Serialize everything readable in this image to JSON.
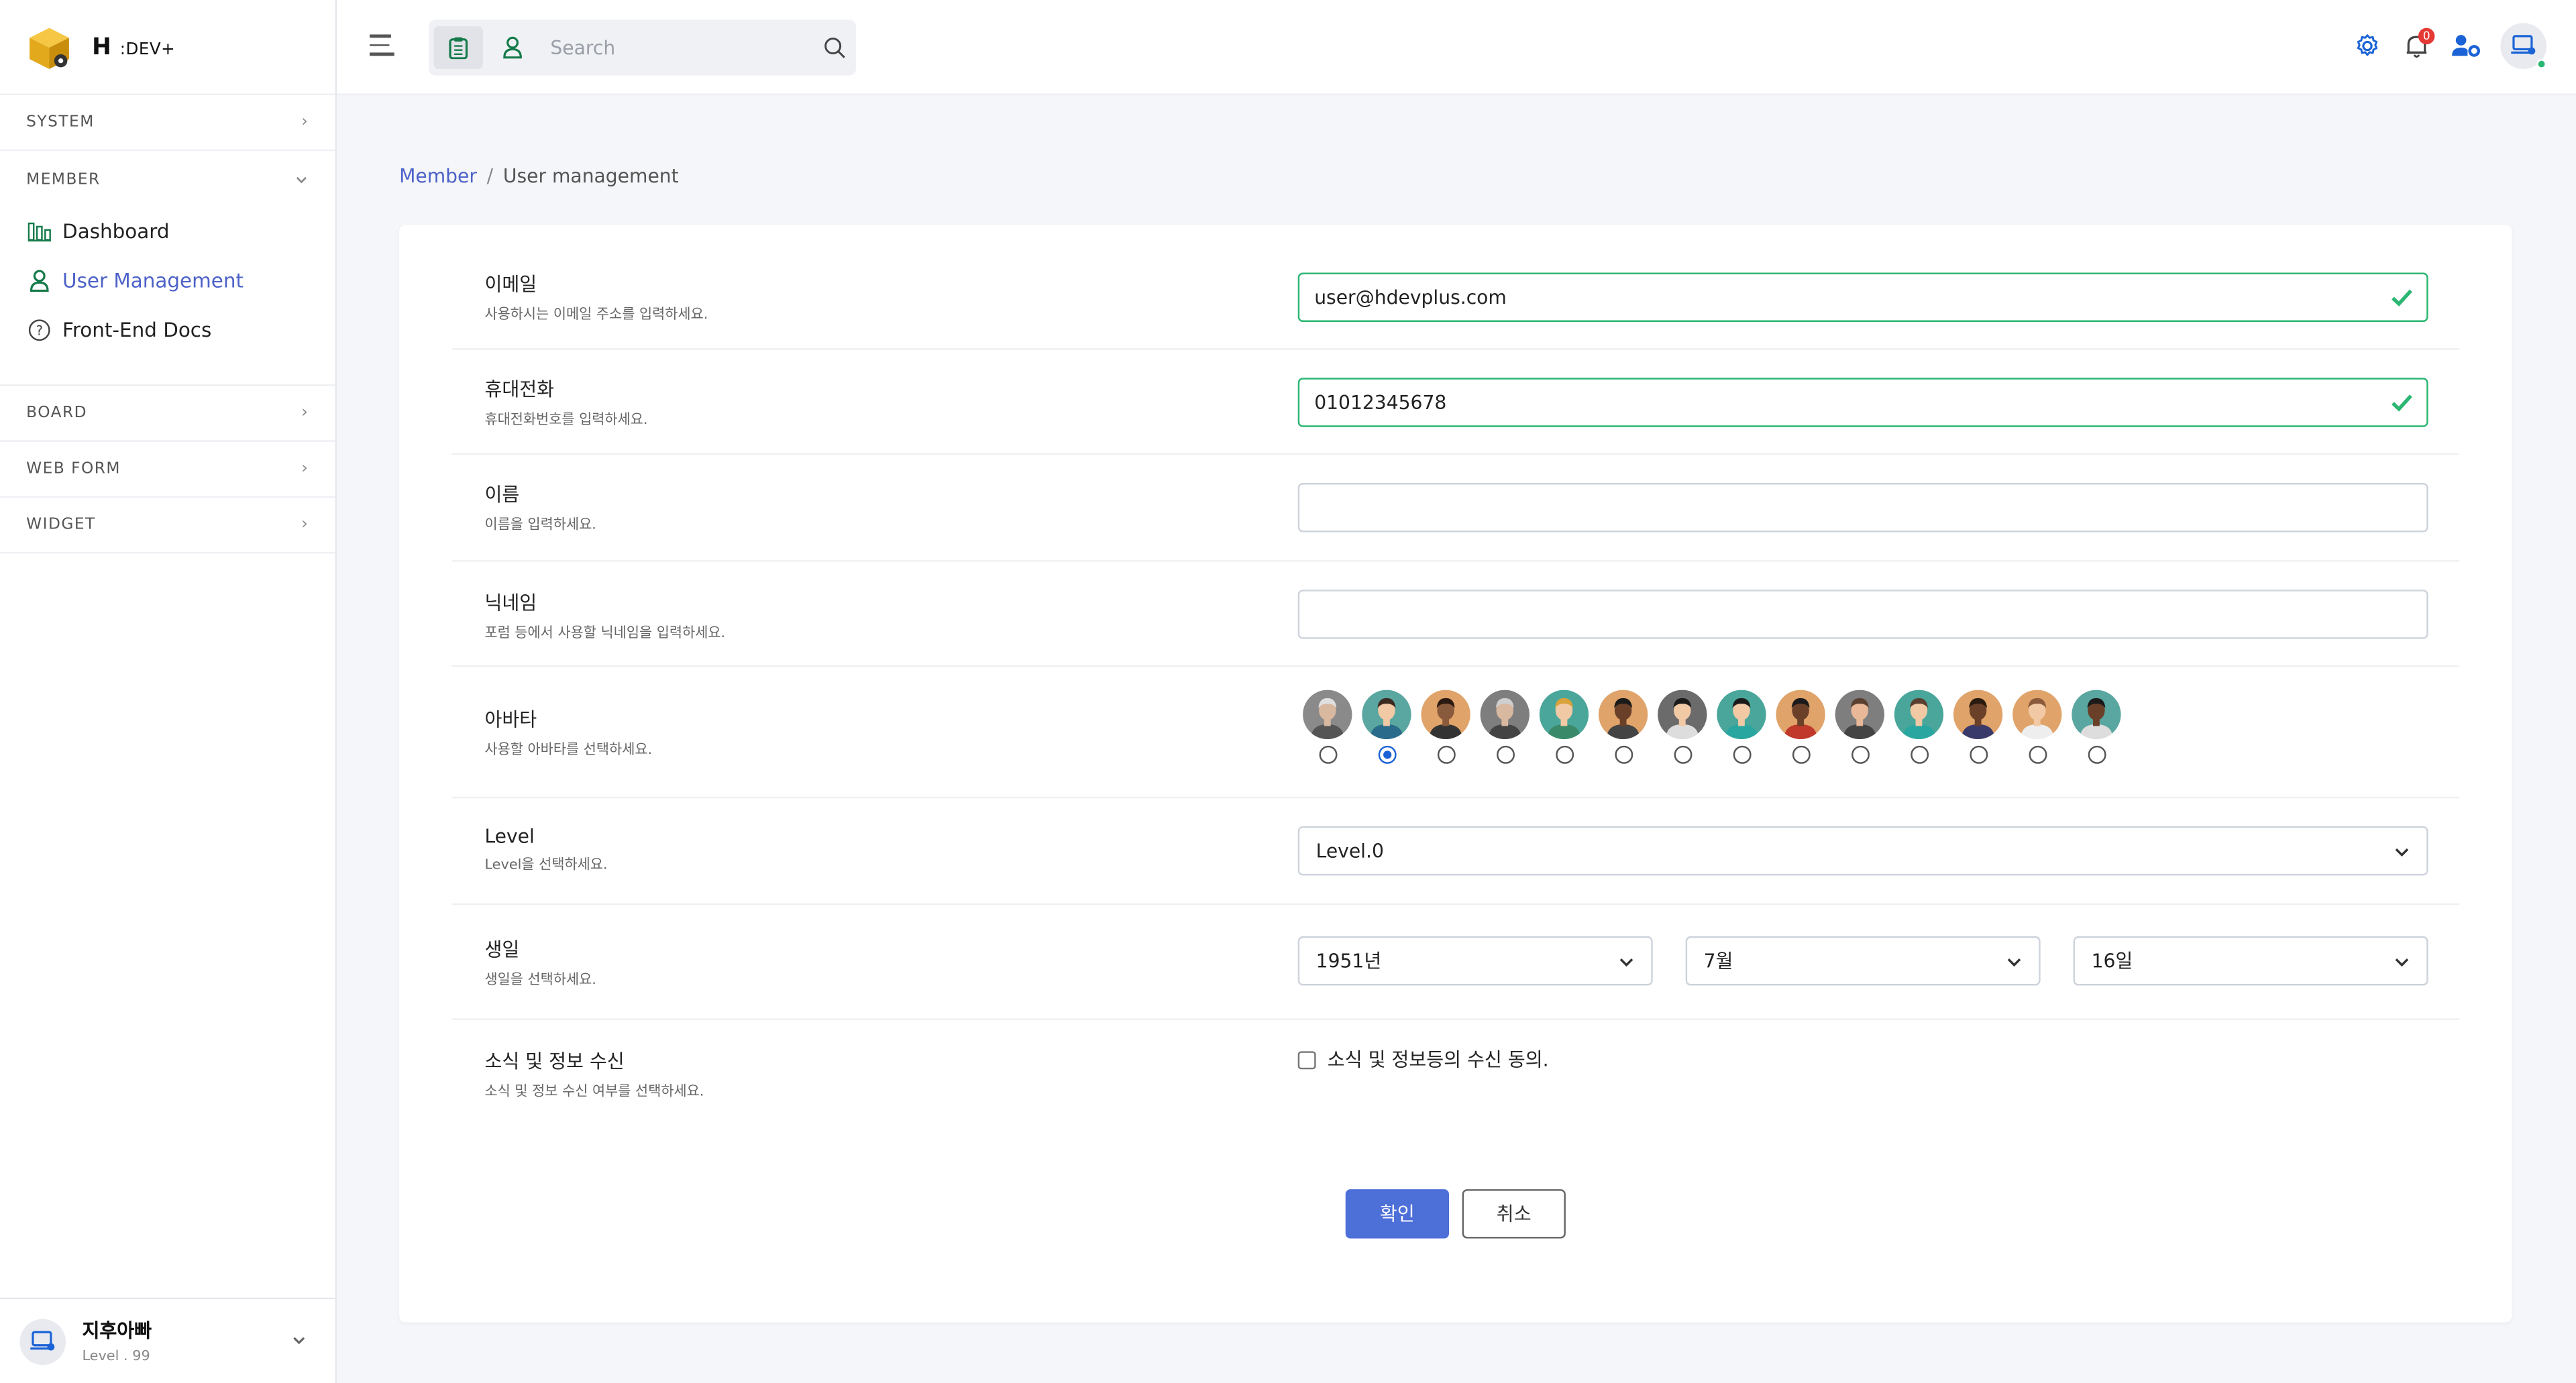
{
  "app": {
    "brand_main": "H",
    "brand_suffix": ":DEV+"
  },
  "sidebar": {
    "sections": {
      "system": "SYSTEM",
      "member": "MEMBER",
      "board": "BOARD",
      "web_form": "WEB FORM",
      "widget": "WIDGET"
    },
    "items": [
      {
        "label": "Dashboard",
        "icon": "bar-chart-icon"
      },
      {
        "label": "User Management",
        "icon": "user-icon",
        "active": true
      },
      {
        "label": "Front-End Docs",
        "icon": "help-circle-icon"
      }
    ],
    "user": {
      "name": "지후아빠",
      "level": "Level . 99"
    }
  },
  "header": {
    "search_placeholder": "Search",
    "notification_count": "0",
    "colors": {
      "accent": "#4d62c8",
      "valid": "#2bb673",
      "badge": "#e53935"
    }
  },
  "breadcrumb": {
    "parent": "Member",
    "sep": "/",
    "current": "User management"
  },
  "form": {
    "email": {
      "label": "이메일",
      "desc": "사용하시는 이메일 주소를 입력하세요.",
      "value": "user@hdevplus.com"
    },
    "phone": {
      "label": "휴대전화",
      "desc": "휴대전화번호를 입력하세요.",
      "value": "01012345678"
    },
    "name": {
      "label": "이름",
      "desc": "이름을 입력하세요.",
      "value": ""
    },
    "nickname": {
      "label": "닉네임",
      "desc": "포럼 등에서 사용할 닉네임을 입력하세요.",
      "value": ""
    },
    "avatar": {
      "label": "아바타",
      "desc": "사용할 아바타를 선택하세요.",
      "selected_index": 1,
      "count": 14
    },
    "level": {
      "label": "Level",
      "desc": "Level을 선택하세요.",
      "value": "Level.0"
    },
    "birthday": {
      "label": "생일",
      "desc": "생일을 선택하세요.",
      "year": "1951년",
      "month": "7월",
      "day": "16일"
    },
    "newsletter": {
      "label": "소식 및 정보 수신",
      "desc": "소식 및 정보 수신 여부를 선택하세요.",
      "checkbox_label": "소식 및 정보등의 수신 동의.",
      "checked": false
    },
    "buttons": {
      "confirm": "확인",
      "cancel": "취소"
    }
  }
}
